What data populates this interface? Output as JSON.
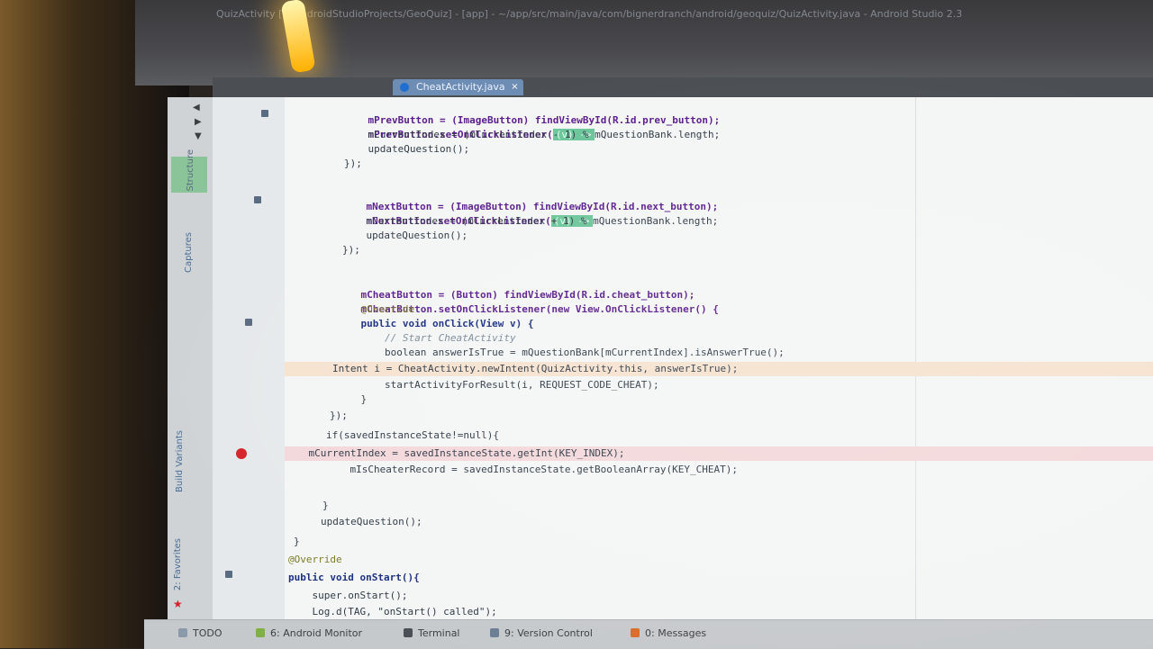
{
  "window": {
    "title": "QuizActivity [~/AndroidStudioProjects/GeoQuiz] - [app] - ~/app/src/main/java/com/bignerdranch/android/geoquiz/QuizActivity.java - Android Studio 2.3"
  },
  "editor": {
    "active_tab": "CheatActivity.java",
    "code_lines": [
      "mPrevButton = (ImageButton) findViewById(R.id.prev_button);",
      "mPrevButton.setOnClickListener(",
      "    mCurrentIndex = (mCurrentIndex - 1) % mQuestionBank.length;",
      "    updateQuestion();",
      "});",
      "mNextButton = (ImageButton) findViewById(R.id.next_button);",
      "mNextButton.setOnClickListener(",
      "    mCurrentIndex = (mCurrentIndex + 1) % mQuestionBank.length;",
      "    updateQuestion();",
      "});",
      "mCheatButton = (Button) findViewById(R.id.cheat_button);",
      "mCheatButton.setOnClickListener(new View.OnClickListener() {",
      "    @Override",
      "    public void onClick(View v) {",
      "        // Start CheatActivity",
      "        boolean answerIsTrue = mQuestionBank[mCurrentIndex].isAnswerTrue();",
      "        Intent i = CheatActivity.newIntent(QuizActivity.this, answerIsTrue);",
      "        startActivityForResult(i, REQUEST_CODE_CHEAT);",
      "    }",
      "});",
      "if(savedInstanceState!=null){",
      "    mCurrentIndex = savedInstanceState.getInt(KEY_INDEX);",
      "    mIsCheaterRecord = savedInstanceState.getBooleanArray(KEY_CHEAT);",
      "}",
      "updateQuestion();",
      "}",
      "@Override",
      "public void onStart(){",
      "    super.onStart();",
      "    Log.d(TAG, \"onStart() called\");"
    ],
    "lambda_hint": "(v) ->"
  },
  "toolstrip": {
    "captures_label": "Captures",
    "structure_label": "Structure",
    "build_variants_label": "Build Variants",
    "favorites_label": "2: Favorites"
  },
  "bottom_bar": {
    "todo": "TODO",
    "android_monitor": "6: Android Monitor",
    "terminal": "Terminal",
    "version_control": "9: Version Control",
    "messages": "0: Messages"
  },
  "colors": {
    "breakpoint": "#d5222a",
    "intention_bulb": "#d87a14",
    "tab_active": "#6e8db5",
    "lambda_fold": "#6cc59a",
    "selection": "#1f4fa0"
  }
}
